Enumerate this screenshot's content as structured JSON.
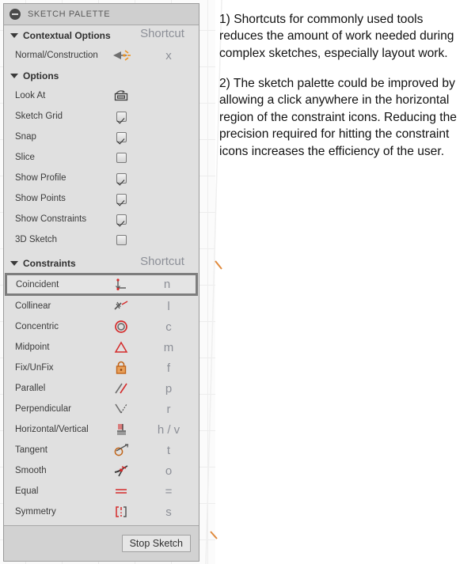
{
  "window": {
    "title": "SKETCH PALETTE",
    "collapse_icon": "minus-circle-icon"
  },
  "sections": {
    "contextual": {
      "title": "Contextual Options",
      "shortcut_header": "Shortcut",
      "rows": [
        {
          "label": "Normal/Construction",
          "icon": "normal-construction-icon",
          "key": "x"
        }
      ]
    },
    "options": {
      "title": "Options",
      "rows": [
        {
          "label": "Look At",
          "icon": "look-at-icon",
          "control": "button"
        },
        {
          "label": "Sketch Grid",
          "icon": "checkbox",
          "checked": true
        },
        {
          "label": "Snap",
          "icon": "checkbox",
          "checked": true
        },
        {
          "label": "Slice",
          "icon": "checkbox",
          "checked": false
        },
        {
          "label": "Show Profile",
          "icon": "checkbox",
          "checked": true
        },
        {
          "label": "Show Points",
          "icon": "checkbox",
          "checked": true
        },
        {
          "label": "Show Constraints",
          "icon": "checkbox",
          "checked": true
        },
        {
          "label": "3D Sketch",
          "icon": "checkbox",
          "checked": false
        }
      ]
    },
    "constraints": {
      "title": "Constraints",
      "shortcut_header": "Shortcut",
      "rows": [
        {
          "label": "Coincident",
          "icon": "coincident-icon",
          "key": "n",
          "selected": true
        },
        {
          "label": "Collinear",
          "icon": "collinear-icon",
          "key": "l",
          "selected": false
        },
        {
          "label": "Concentric",
          "icon": "concentric-icon",
          "key": "c",
          "selected": false
        },
        {
          "label": "Midpoint",
          "icon": "midpoint-icon",
          "key": "m",
          "selected": false
        },
        {
          "label": "Fix/UnFix",
          "icon": "fix-unfix-lock-icon",
          "key": "f",
          "selected": false
        },
        {
          "label": "Parallel",
          "icon": "parallel-icon",
          "key": "p",
          "selected": false
        },
        {
          "label": "Perpendicular",
          "icon": "perpendicular-icon",
          "key": "r",
          "selected": false
        },
        {
          "label": "Horizontal/Vertical",
          "icon": "horizontal-vertical-icon",
          "key": "h / v",
          "selected": false
        },
        {
          "label": "Tangent",
          "icon": "tangent-icon",
          "key": "t",
          "selected": false
        },
        {
          "label": "Smooth",
          "icon": "smooth-icon",
          "key": "o",
          "selected": false
        },
        {
          "label": "Equal",
          "icon": "equal-icon",
          "key": "=",
          "selected": false
        },
        {
          "label": "Symmetry",
          "icon": "symmetry-icon",
          "key": "s",
          "selected": false
        }
      ]
    }
  },
  "footer": {
    "stop_sketch_label": "Stop Sketch"
  },
  "annotations": [
    "1) Shortcuts for commonly used tools reduces the amount of work needed during complex sketches, especially layout work.",
    "2) The sketch palette could be improved by allowing a click anywhere in the horizontal region of the constraint icons.  Reducing the precision required for hitting the constraint icons increases the efficiency of the user."
  ],
  "colors": {
    "constraint_icon_red": "#d42a2a",
    "constraint_icon_gray": "#555555",
    "lock_orange": "#c1651a",
    "shortcut_text": "#8c8f97",
    "panel_bg": "#e0e0e0",
    "titlebar_bg": "#cfcfcf",
    "selection_border": "#7d7d7d"
  }
}
